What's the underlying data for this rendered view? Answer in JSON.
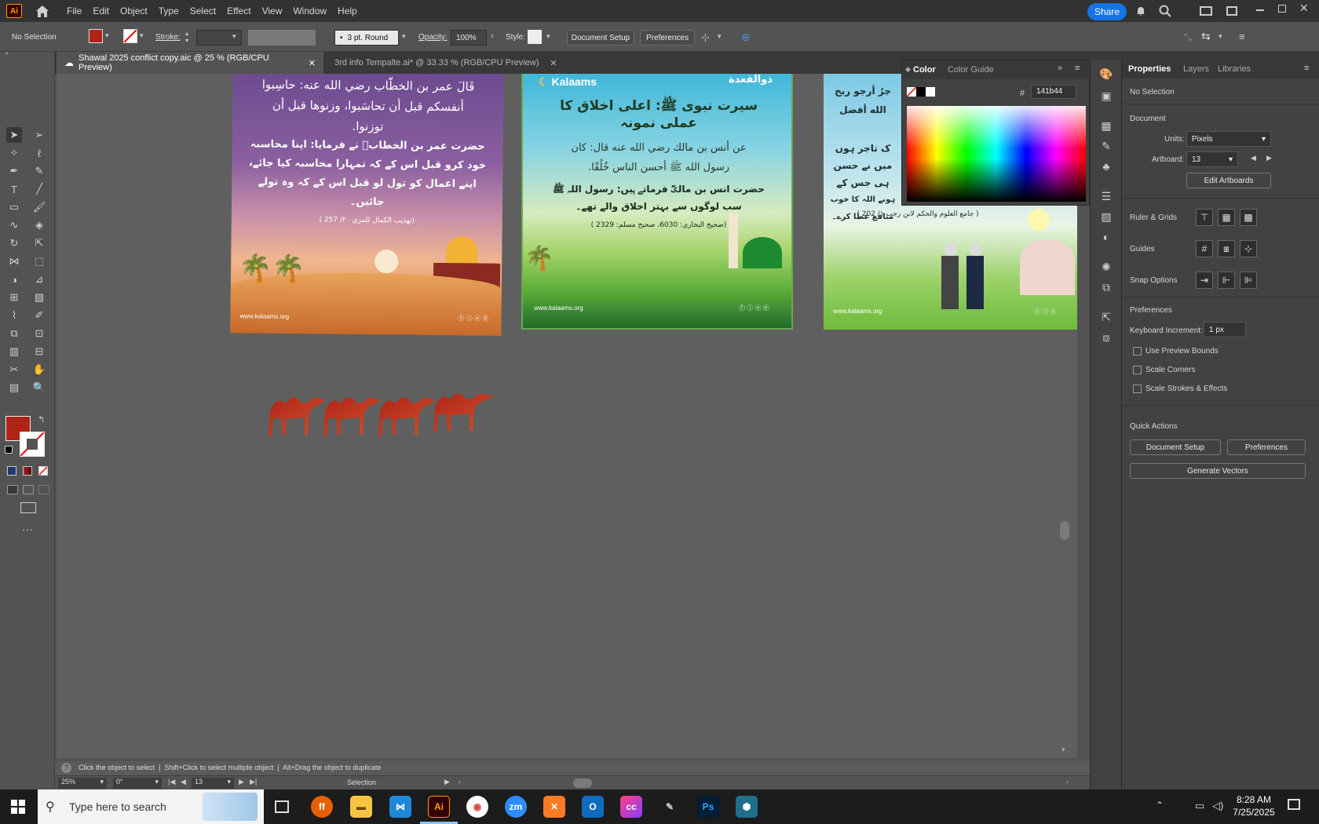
{
  "app": {
    "logo": "Ai",
    "menu": [
      "File",
      "Edit",
      "Object",
      "Type",
      "Select",
      "Effect",
      "View",
      "Window",
      "Help"
    ],
    "share_label": "Share"
  },
  "control_bar": {
    "selection": "No Selection",
    "stroke_label": "Stroke:",
    "brush": "3 pt. Round",
    "opacity_label": "Opacity:",
    "opacity_value": "100%",
    "style_label": "Style:",
    "document_setup": "Document Setup",
    "preferences": "Preferences"
  },
  "tabs": [
    {
      "label": "Shawal 2025 conflict copy.aic @ 25 % (RGB/CPU Preview)",
      "active": true
    },
    {
      "label": "3rd info Tempalte.ai* @ 33.33 % (RGB/CPU Preview)",
      "active": false
    }
  ],
  "artboards": {
    "a1": {
      "lines": [
        "قَالَ عمر بن الخطّاب رضي الله عنه: حاسِبوا",
        "أنفسكم قبل أن تحاسَبوا، وزنوها قبل أن",
        "توزنوا.",
        "حضرت عمر بن الخطابؓ نے فرمایا: اپنا محاسبہ",
        "خود کرو قبل اس کے کہ تمہارا محاسبہ کیا جائے،",
        "اپنے اعمال کو تول لو قبل اس کے کہ وہ تولے",
        "جائیں۔"
      ],
      "ref": "(تهذيب الكمال للمزي ٢٠/ 257 )",
      "site": "www.kalaams.org"
    },
    "a2": {
      "brand": "Kalaams",
      "badge": "ذوالقعدة",
      "title1": "سیرت نبوی ﷺ: اعلی اخلاق کا",
      "title2": "عملی نمونہ",
      "arabic1": "عن أنس بن مالك رضي الله عنه قال: كان",
      "arabic2": "رسول الله ﷺ أحسن الناس خُلُقًا.",
      "urdu1": "حضرت انس بن مالکؓ فرماتے ہیں: رسول اللہ ﷺ",
      "urdu2": "سب لوگوں سے بہتر اخلاق والے تھے۔",
      "ref": "(صحيح البخاري: 6030، صحيح مسلم: 2329 )",
      "site": "www.kalaams.org"
    },
    "a3": {
      "lines": [
        "جرُ أرجو ربح",
        "الله أفضل",
        "ک تاجر ہوں",
        "میں نے حسن",
        "ہی جس کے",
        "ہونے اللہ کا خوب منافع عطا کرے۔"
      ],
      "ref": "( جامع العلوم والحكم لابن رجب ١/ 202 )",
      "site": "www.kalaams.org"
    }
  },
  "color_panel": {
    "tab_color": "Color",
    "tab_guide": "Color Guide",
    "hex_label": "#",
    "hex_value": "141b44"
  },
  "properties": {
    "tabs": [
      "Properties",
      "Layers",
      "Libraries"
    ],
    "no_selection": "No Selection",
    "document_heading": "Document",
    "units_label": "Units:",
    "units_value": "Pixels",
    "artboard_label": "Artboard:",
    "artboard_value": "13",
    "edit_artboards": "Edit Artboards",
    "ruler_grids": "Ruler & Grids",
    "guides": "Guides",
    "snap_options": "Snap Options",
    "preferences_heading": "Preferences",
    "keyboard_increment_label": "Keyboard Increment:",
    "keyboard_increment_value": "1 px",
    "use_preview_bounds": "Use Preview Bounds",
    "scale_corners": "Scale Corners",
    "scale_strokes": "Scale Strokes & Effects",
    "quick_actions": "Quick Actions",
    "document_setup": "Document Setup",
    "preferences_btn": "Preferences",
    "generate_vectors": "Generate Vectors"
  },
  "status": {
    "hint": "Click the object to select  |  Shift+Click to select multiple object  |  Alt+Drag the object to duplicate",
    "zoom": "25%",
    "rotation": "0°",
    "artboard": "13",
    "tool": "Selection"
  },
  "taskbar": {
    "search_placeholder": "Type here to search",
    "time": "8:28 AM",
    "date": "7/25/2025",
    "zoom_app": "zm",
    "ai_app": "Ai",
    "ps_app": "Ps"
  },
  "colors": {
    "fill": "#b02418",
    "accent": "#1473e6"
  }
}
